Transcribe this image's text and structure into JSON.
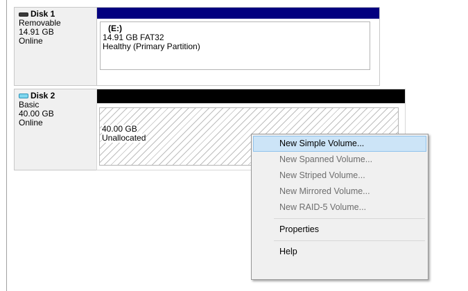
{
  "disks": [
    {
      "name": "Disk 1",
      "icon": "removable-drive-icon",
      "type": "Removable",
      "size": "14.91 GB",
      "status": "Online",
      "volume": {
        "label": "(E:)",
        "detail": "14.91 GB FAT32",
        "health": "Healthy (Primary Partition)",
        "header_color": "#03007f"
      }
    },
    {
      "name": "Disk 2",
      "icon": "basic-disk-icon",
      "type": "Basic",
      "size": "40.00 GB",
      "status": "Online",
      "volume": {
        "size": "40.00 GB",
        "state": "Unallocated",
        "header_color": "#000000"
      }
    }
  ],
  "context_menu": {
    "items": [
      {
        "label": "New Simple Volume...",
        "enabled": true,
        "selected": true
      },
      {
        "label": "New Spanned Volume...",
        "enabled": false
      },
      {
        "label": "New Striped Volume...",
        "enabled": false
      },
      {
        "label": "New Mirrored Volume...",
        "enabled": false
      },
      {
        "label": "New RAID-5 Volume...",
        "enabled": false
      },
      {
        "label": "Properties",
        "enabled": true
      },
      {
        "label": "Help",
        "enabled": true
      }
    ]
  }
}
